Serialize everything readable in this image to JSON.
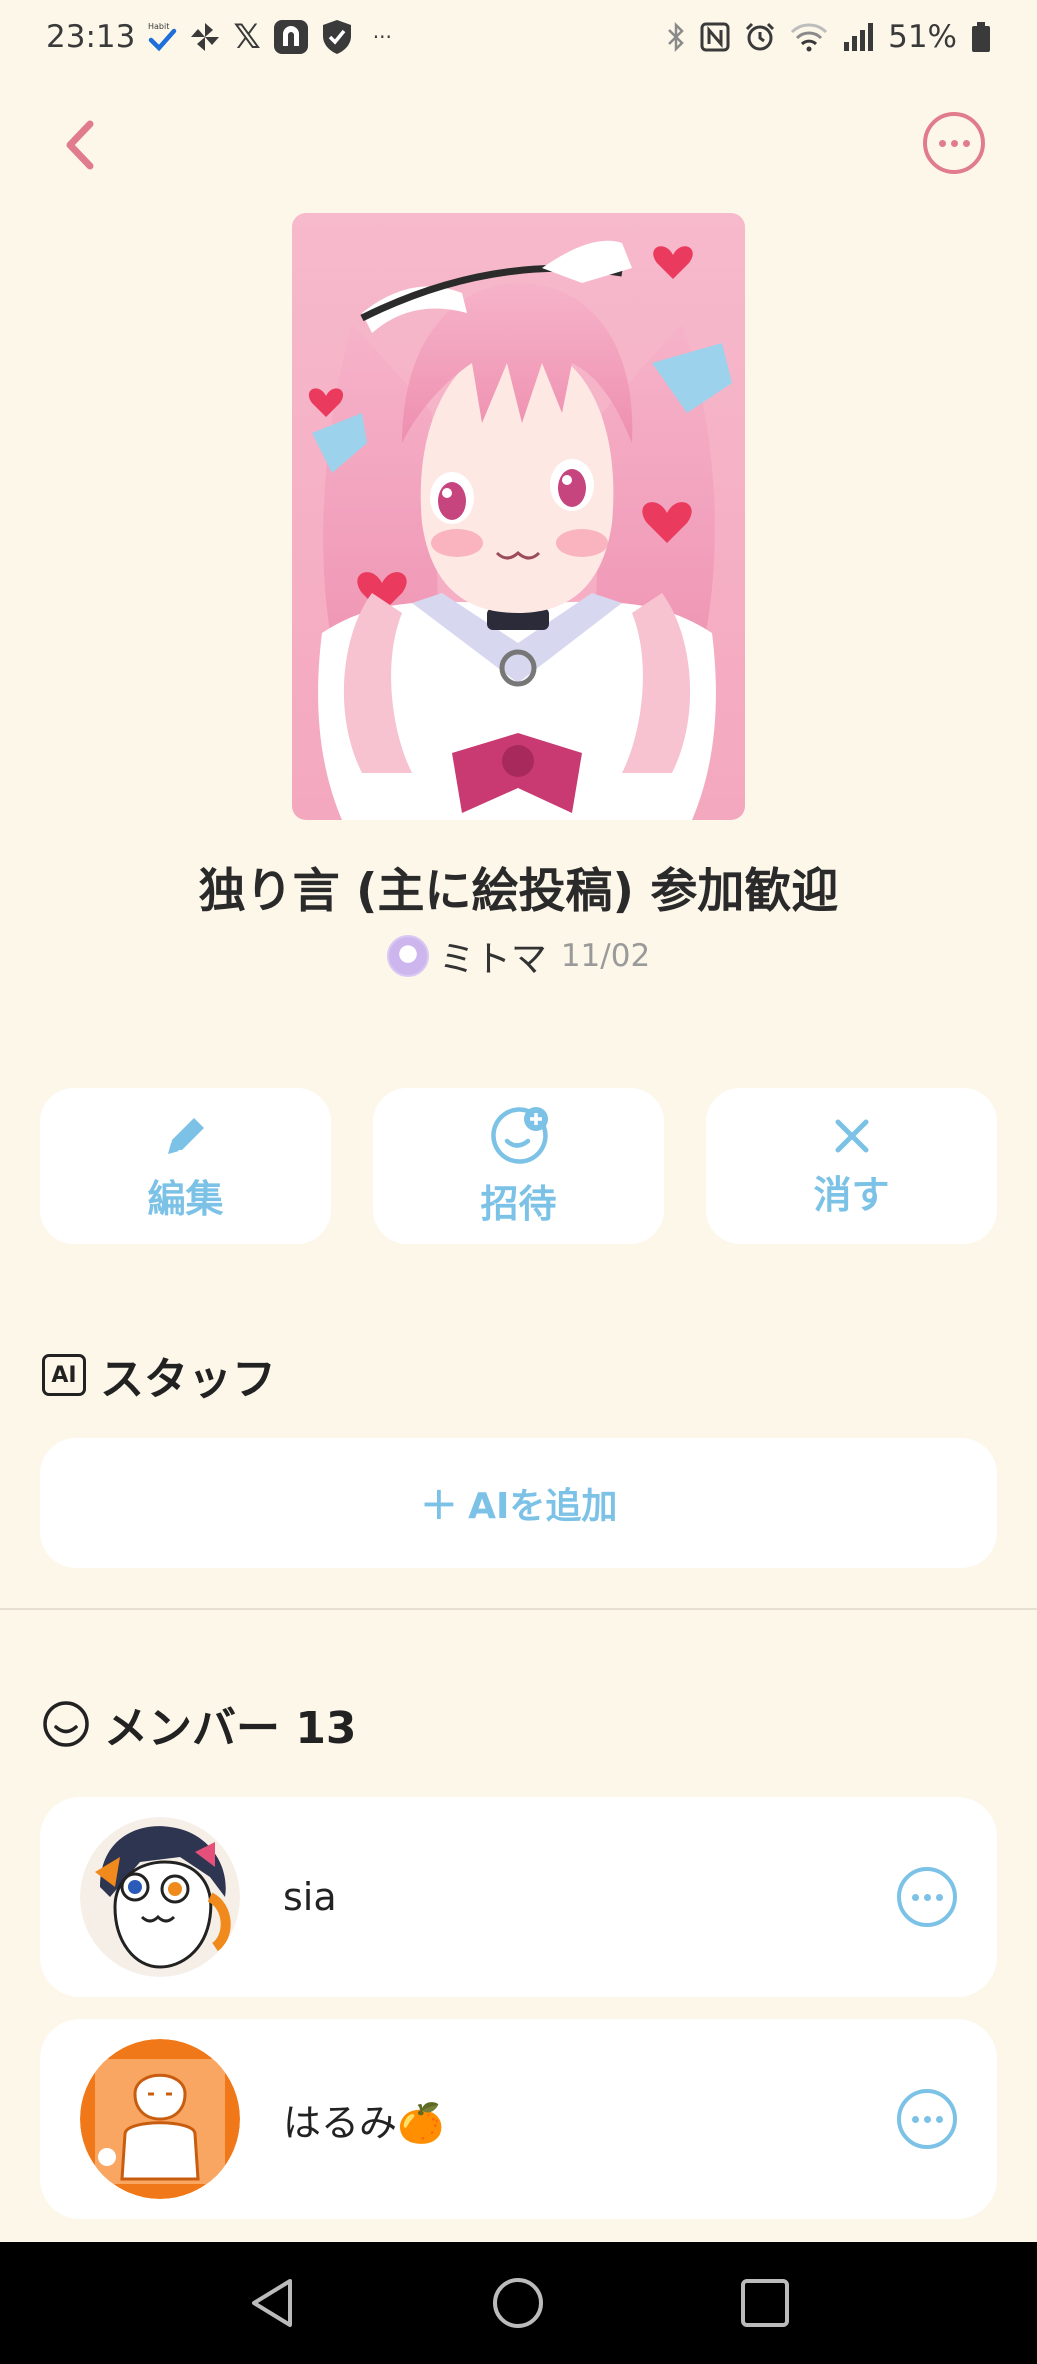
{
  "status": {
    "time": "23:13",
    "battery": "51%",
    "habit_label": "Habit",
    "x_label": "𝕏",
    "dots": "···"
  },
  "header": {
    "back_icon": "chevron-left-icon",
    "more_icon": "ellipsis-circle-icon",
    "accent": "#e07c8b"
  },
  "room": {
    "title": "独り言 (主に絵投稿) 参加歓迎",
    "creator": "ミトマ",
    "date": "11/02"
  },
  "actions": [
    {
      "label": "編集",
      "icon": "pencil-icon"
    },
    {
      "label": "招待",
      "icon": "invite-face-plus-icon"
    },
    {
      "label": "消す",
      "icon": "close-icon"
    }
  ],
  "staff": {
    "badge": "AI",
    "heading": "スタッフ",
    "add_plus": "+",
    "add_label": "AIを追加"
  },
  "members": {
    "heading": "メンバー 13",
    "list": [
      {
        "name": "sia"
      },
      {
        "name": "はるみ🍊"
      }
    ]
  },
  "colors": {
    "background": "#fdf7ea",
    "action_blue": "#7cc2e6",
    "card": "#ffffff"
  }
}
